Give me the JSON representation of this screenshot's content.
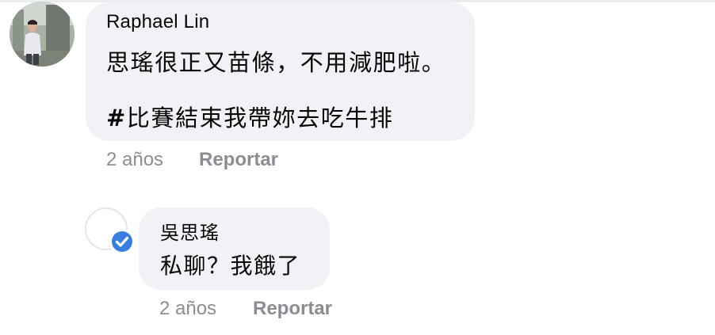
{
  "comments": [
    {
      "author": "Raphael Lin",
      "text_line1": "思瑤很正又苗條，不用減肥啦。",
      "hashtag_symbol": "#",
      "hashtag_text": "比賽結束我帶妳去吃牛排",
      "time": "2 años",
      "report_label": "Reportar",
      "avatar_icon": "user-photo-avatar"
    }
  ],
  "reply": {
    "author": "吳思瑤",
    "text": "私聊？我餓了",
    "time": "2 años",
    "report_label": "Reportar",
    "badge_icon": "verified-check-icon",
    "badge_color": "#3b7ddd"
  },
  "colors": {
    "bubble": "#f0f2f5",
    "meta_text": "#8a8d91",
    "body_text": "#050505"
  }
}
